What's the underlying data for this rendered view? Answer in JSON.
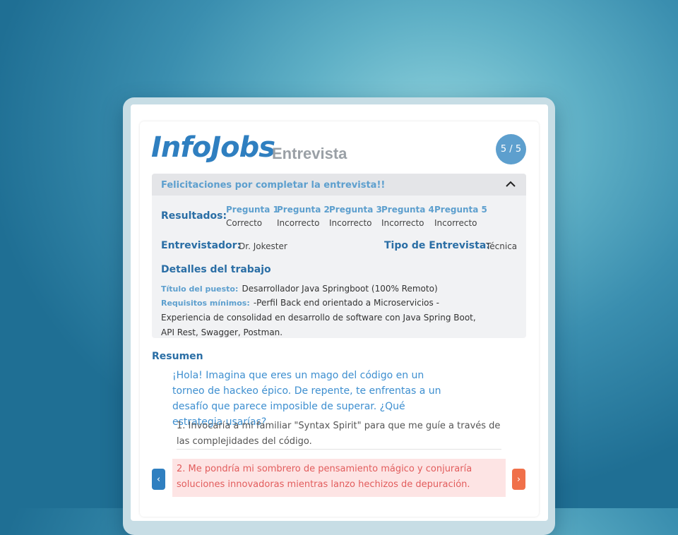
{
  "header": {
    "brand": "InfoJobs",
    "subtitle": "Entrevista",
    "progress": "5 / 5"
  },
  "banner": {
    "message": "Felicitaciones por completar la entrevista!!"
  },
  "results": {
    "label": "Resultados:",
    "questions": [
      {
        "name": "Pregunta 1",
        "result": "Correcto"
      },
      {
        "name": "Pregunta 2",
        "result": "Incorrecto"
      },
      {
        "name": "Pregunta 3",
        "result": "Incorrecto"
      },
      {
        "name": "Pregunta 4",
        "result": "Incorrecto"
      },
      {
        "name": "Pregunta 5",
        "result": "Incorrecto"
      }
    ]
  },
  "interviewer": {
    "label": "Entrevistador:",
    "value": "Dr. Jokester"
  },
  "interview_type": {
    "label": "Tipo de Entrevista:",
    "value": "Técnica"
  },
  "job": {
    "heading": "Detalles del trabajo",
    "title_label": "Título del puesto:",
    "title_value": "Desarrollador Java Springboot (100% Remoto)",
    "req_label": "Requisitos mínimos:",
    "req_value": "-Perfil Back end orientado a Microservicios - Experiencia de consolidad en desarrollo de software con Java Spring Boot, API Rest, Swagger, Postman."
  },
  "summary": {
    "heading": "Resumen",
    "question": "¡Hola! Imagina que eres un mago del código en un torneo de hackeo épico. De repente, te enfrentas a un desafío que parece imposible de superar. ¿Qué estrategia usarías?",
    "answers": [
      "1. Invocaría a mi familiar \"Syntax Spirit\" para que me guíe a través de las complejidades del código.",
      "2. Me pondría mi sombrero de pensamiento mágico y conjuraría soluciones innovadoras mientras lanzo hechizos de depuración."
    ]
  },
  "nav": {
    "prev": "‹",
    "next": "›"
  },
  "colors": {
    "accent": "#2a6ea5",
    "light_accent": "#5d9fce",
    "prev_button": "#2f7fc0",
    "next_button": "#f0704a",
    "wrong_answer": "#e25c5c"
  }
}
